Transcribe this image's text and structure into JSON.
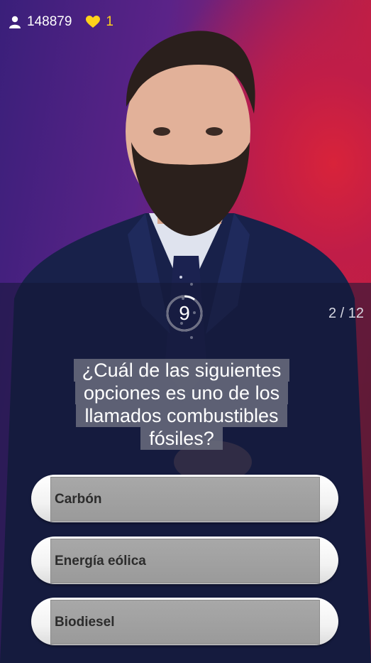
{
  "stats": {
    "players_icon": "user-icon",
    "players_count": "148879",
    "lives_icon": "heart-icon",
    "lives_count": "1",
    "lives_color": "#ffd21a"
  },
  "timer": {
    "seconds": "9",
    "remaining_fraction": 0.1
  },
  "progress": "2 / 12",
  "question": {
    "lines": [
      "¿Cuál de las siguientes",
      "opciones es uno de los",
      "llamados combustibles",
      "fósiles?"
    ]
  },
  "answers": [
    {
      "label": "Carbón"
    },
    {
      "label": "Energía eólica"
    },
    {
      "label": "Biodiesel"
    }
  ]
}
